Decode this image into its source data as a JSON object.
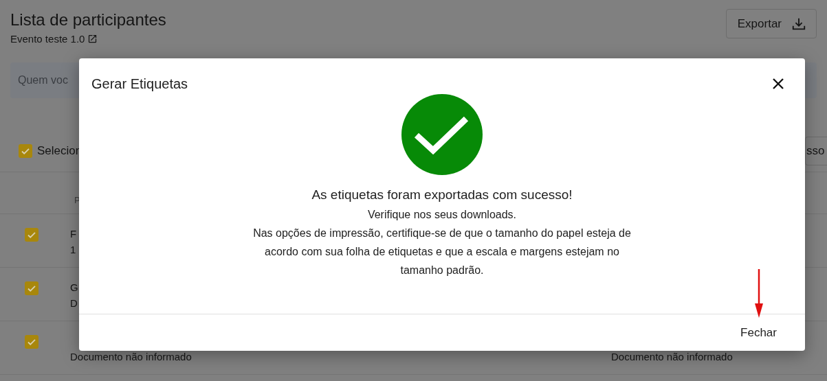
{
  "page": {
    "title": "Lista de participantes",
    "event_link": "Evento teste 1.0",
    "export_button": "Exportar",
    "search": {
      "placeholder": "Quem voc"
    },
    "select_all": {
      "label": "Selecion",
      "checked": true
    },
    "right_button": "sso",
    "table": {
      "column_1": "P",
      "rows": [
        {
          "checked": true,
          "line_1": "F",
          "line_2": "1"
        },
        {
          "checked": true,
          "line_1": "G",
          "line_2": "D"
        },
        {
          "checked": true,
          "line_2": "Documento não informado",
          "column_5_line_2": "Documento não informado"
        }
      ]
    }
  },
  "dialog": {
    "title": "Gerar Etiquetas",
    "heading": "As etiquetas foram exportadas com sucesso!",
    "lines": [
      "Verifique nos seus downloads.",
      "Nas opções de impressão, certifique-se de que o tamanho do papel esteja de acordo com sua folha de etiquetas e que a escala e margens estejam no tamanho padrão."
    ],
    "close_button": "Fechar"
  }
}
